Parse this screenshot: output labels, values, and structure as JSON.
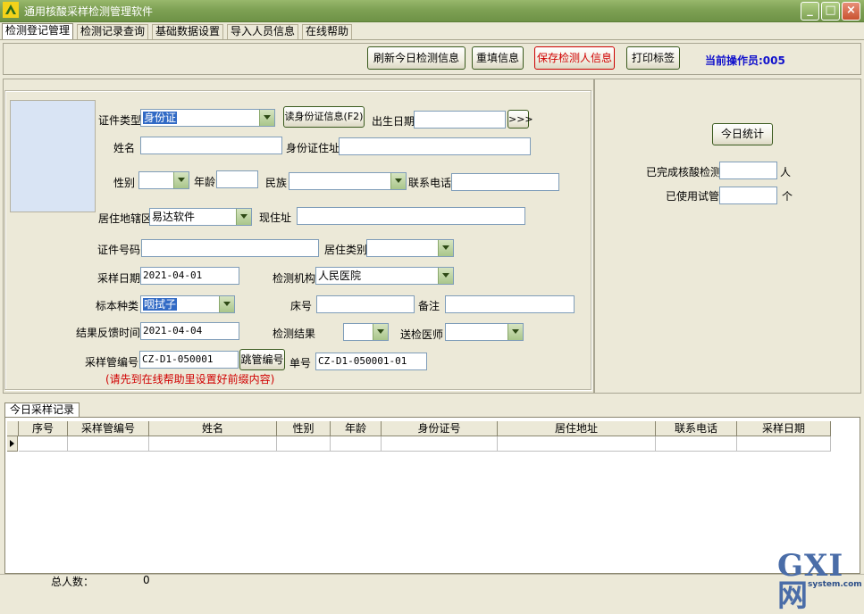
{
  "window": {
    "title": "通用核酸采样检测管理软件",
    "minimize": "_",
    "maximize": "□",
    "close": "×"
  },
  "menu": {
    "tabs": [
      "检测登记管理",
      "检测记录查询",
      "基础数据设置",
      "导入人员信息",
      "在线帮助"
    ]
  },
  "toolbar": {
    "refresh_label": "刷新今日检测信息",
    "refill_label": "重填信息",
    "save_label": "保存检测人信息",
    "print_label": "打印标签",
    "operator_text": "当前操作员:005"
  },
  "form": {
    "id_type_label": "证件类型",
    "id_type_value": "身份证",
    "read_id_button": "读身份证信息(F2)",
    "birth_label": "出生日期",
    "birth_value": "",
    "birth_go": ">>>",
    "name_label": "姓名",
    "name_value": "",
    "id_addr_label": "身份证住址",
    "id_addr_value": "",
    "gender_label": "性别",
    "gender_value": "",
    "age_label": "年龄",
    "age_value": "",
    "ethnic_label": "民族",
    "ethnic_value": "",
    "phone_label": "联系电话",
    "phone_value": "",
    "district_label": "居住地辖区",
    "district_value": "易达软件",
    "current_addr_label": "现住址",
    "current_addr_value": "",
    "id_no_label": "证件号码",
    "id_no_value": "",
    "residence_label": "居住类别",
    "residence_value": "",
    "sample_date_label": "采样日期",
    "sample_date_value": "2021-04-01",
    "agency_label": "检测机构",
    "agency_value": "人民医院",
    "specimen_label": "标本种类",
    "specimen_value": "咽拭子",
    "bed_label": "床号",
    "bed_value": "",
    "remark_label": "备注",
    "remark_value": "",
    "feedback_label": "结果反馈时间",
    "feedback_value": "2021-04-04",
    "result_label": "检测结果",
    "result_value": "",
    "doctor_label": "送检医师",
    "doctor_value": "",
    "tube_label": "采样管编号",
    "tube_value": "CZ-D1-050001",
    "skip_tube_button": "跳管编号",
    "order_label": "单号",
    "order_value": "CZ-D1-050001-01",
    "note": "(请先到在线帮助里设置好前缀内容)"
  },
  "stats": {
    "today_button": "今日统计",
    "completed_label": "已完成核酸检测",
    "completed_value": "",
    "completed_unit": "人",
    "used_label": "已使用试管",
    "used_value": "",
    "used_unit": "个"
  },
  "records": {
    "tab_label": "今日采样记录",
    "columns": [
      "序号",
      "采样管编号",
      "姓名",
      "性别",
      "年龄",
      "身份证号",
      "居住地址",
      "联系电话",
      "采样日期"
    ],
    "rows": []
  },
  "status": {
    "total_label": "总人数：",
    "total_value": "0"
  },
  "watermark": {
    "logo": "GXI网",
    "domain": "system.com"
  }
}
